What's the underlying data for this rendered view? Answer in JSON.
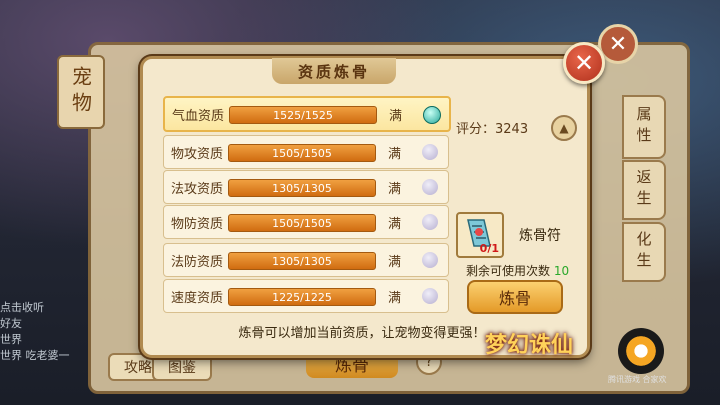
{
  "background": {
    "pet_tab": "宠物",
    "side_tabs": [
      "属性",
      "返生",
      "化生"
    ],
    "bottom_buttons": [
      "攻略",
      "图鉴"
    ],
    "refine_button_ghost": "炼骨",
    "help": "?",
    "chat_lines": [
      "点击收听",
      "好友",
      "世界",
      "世界 吃老婆一"
    ]
  },
  "dialog": {
    "title": "资质炼骨",
    "close_label": "✕",
    "rows": [
      {
        "name": "气血资质",
        "value": "1525/1525",
        "full": "满",
        "selected": true
      },
      {
        "name": "物攻资质",
        "value": "1505/1505",
        "full": "满",
        "selected": false
      },
      {
        "name": "法攻资质",
        "value": "1305/1305",
        "full": "满",
        "selected": false
      },
      {
        "name": "物防资质",
        "value": "1505/1505",
        "full": "满",
        "selected": false
      },
      {
        "name": "法防资质",
        "value": "1305/1305",
        "full": "满",
        "selected": false
      },
      {
        "name": "速度资质",
        "value": "1225/1225",
        "full": "满",
        "selected": false
      }
    ],
    "score_label": "评分：",
    "score_value": "3243",
    "item": {
      "name": "炼骨符",
      "count": "0/1"
    },
    "remain_label": "剩余可使用次数",
    "remain_value": "10",
    "refine_button": "炼骨",
    "hint": "炼骨可以增加当前资质，让宠物变得更强！"
  },
  "branding": {
    "game_logo": "梦幻诛仙",
    "publisher_text": "腾讯游戏 合家欢"
  },
  "colors": {
    "bar": "#e08428",
    "accent_gold": "#e8b44a",
    "count_red": "#d01818",
    "remain_green": "#2aa82a"
  }
}
